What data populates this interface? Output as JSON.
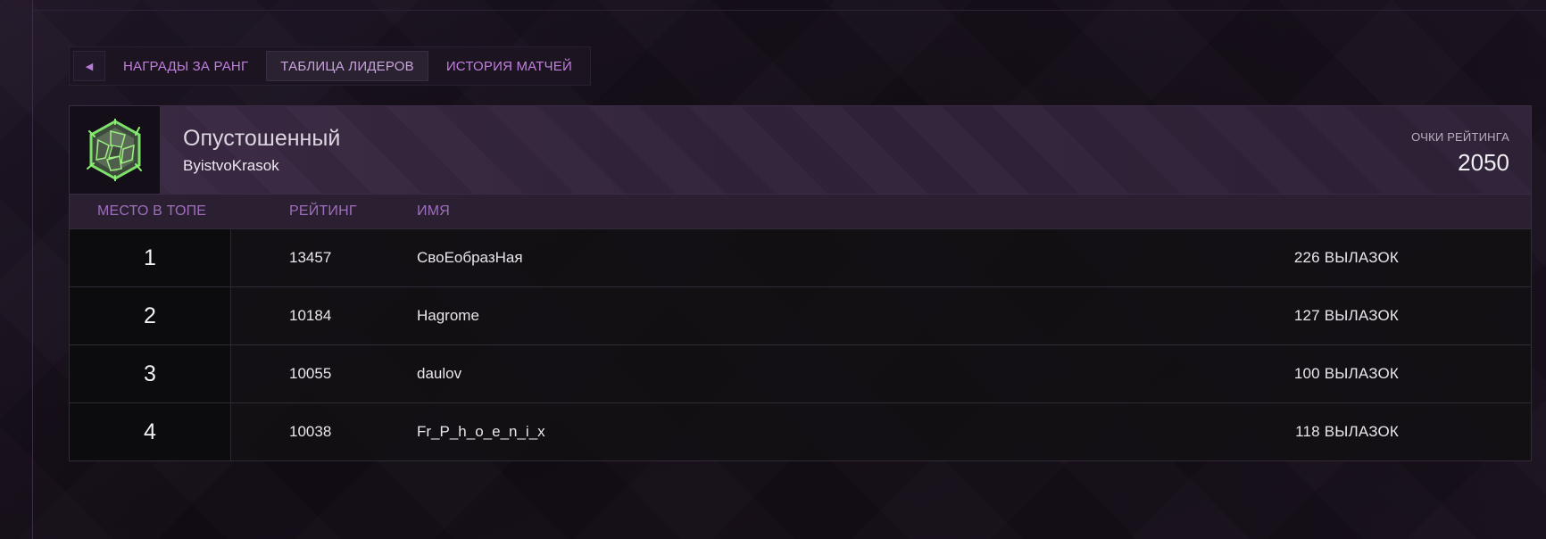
{
  "tabs": {
    "back_icon": "triangle-left-icon",
    "items": [
      {
        "label": "НАГРАДЫ ЗА РАНГ",
        "active": false
      },
      {
        "label": "ТАБЛИЦА ЛИДЕРОВ",
        "active": true
      },
      {
        "label": "ИСТОРИЯ МАТЧЕЙ",
        "active": false
      }
    ]
  },
  "player": {
    "rank_icon": "green-cracked-emblem-icon",
    "rank_name": "Опустошенный",
    "name": "ByistvoKrasok",
    "points_label": "ОЧКИ РЕЙТИНГА",
    "points": "2050"
  },
  "columns": {
    "place": "МЕСТО В ТОПЕ",
    "rating": "РЕЙТИНГ",
    "name": "ИМЯ"
  },
  "rows": [
    {
      "place": "1",
      "rating": "13457",
      "name": "СвоЕобразНая",
      "sorties": "226 ВЫЛАЗОК"
    },
    {
      "place": "2",
      "rating": "10184",
      "name": "Hagrome",
      "sorties": "127 ВЫЛАЗОК"
    },
    {
      "place": "3",
      "rating": "10055",
      "name": "daulov",
      "sorties": "100 ВЫЛАЗОК"
    },
    {
      "place": "4",
      "rating": "10038",
      "name": "Fr_P_h_o_e_n_i_x",
      "sorties": "118 ВЫЛАЗОК"
    }
  ],
  "colors": {
    "accent": "#c27fe0",
    "header_text": "#9d6ebc",
    "emblem_green": "#7ee06a"
  }
}
